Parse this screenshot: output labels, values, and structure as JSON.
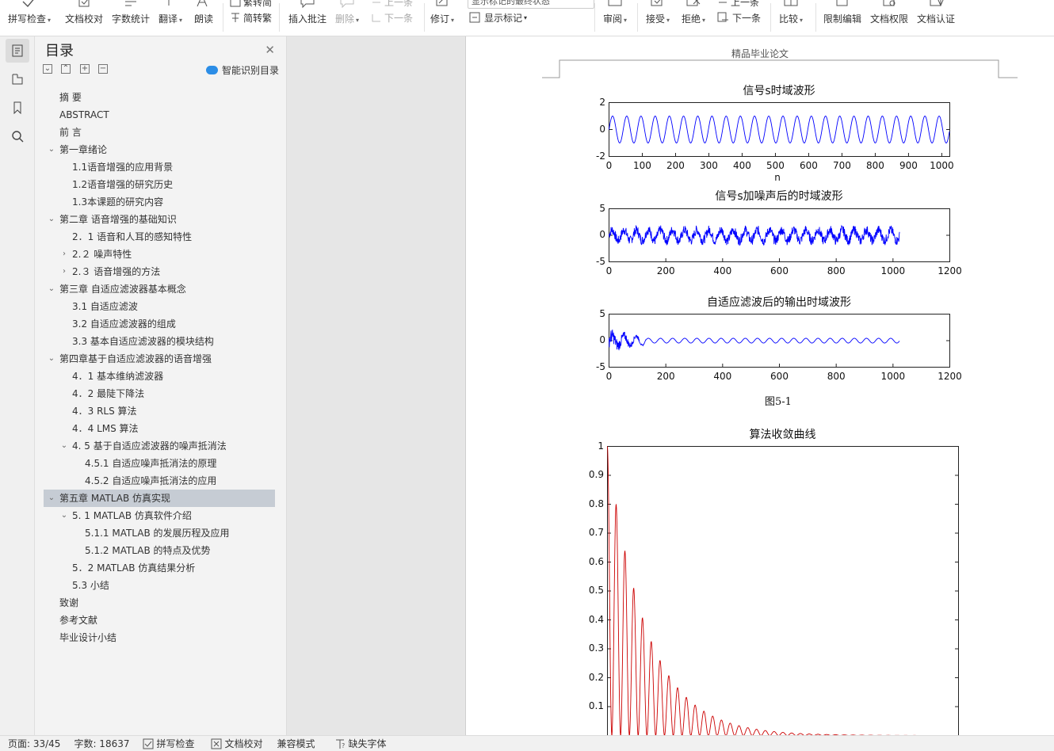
{
  "ribbon": {
    "spell_check": "拼写检查",
    "doc_proof": "文档校对",
    "word_count": "字数统计",
    "translate": "翻译",
    "read_aloud": "朗读",
    "trad_simp_top": "繁转简",
    "simp_trad": "简转繁",
    "insert_comment": "插入批注",
    "delete": "删除",
    "prev_top": "上一条",
    "next": "下一条",
    "revise": "修订",
    "show_markup_top": "显示标记的最终状态",
    "show_markup": "显示标记",
    "review": "审阅",
    "accept": "接受",
    "reject": "拒绝",
    "prev_change_top": "上一条",
    "next_change": "下一条",
    "compare": "比较",
    "restrict_edit": "限制编辑",
    "doc_permission": "文档权限",
    "doc_certify": "文档认证"
  },
  "toc": {
    "title": "目录",
    "smart": "智能识别目录",
    "items": [
      {
        "label": "摘  要",
        "level": 1,
        "arrow": ""
      },
      {
        "label": "ABSTRACT",
        "level": 1,
        "arrow": ""
      },
      {
        "label": "前  言",
        "level": 1,
        "arrow": ""
      },
      {
        "label": "第一章绪论",
        "level": 1,
        "arrow": "down"
      },
      {
        "label": "1.1语音增强的应用背景",
        "level": 2,
        "arrow": ""
      },
      {
        "label": "1.2语音增强的研究历史",
        "level": 2,
        "arrow": ""
      },
      {
        "label": "1.3本课题的研究内容",
        "level": 2,
        "arrow": ""
      },
      {
        "label": "第二章 语音增强的基础知识",
        "level": 1,
        "arrow": "down"
      },
      {
        "label": "2．1 语音和人耳的感知特性",
        "level": 2,
        "arrow": ""
      },
      {
        "label": "2.２ 噪声特性",
        "level": 2,
        "arrow": "right"
      },
      {
        "label": "2.３   语音增强的方法",
        "level": 2,
        "arrow": "right"
      },
      {
        "label": "第三章   自适应滤波器基本概念",
        "level": 1,
        "arrow": "down"
      },
      {
        "label": "3.1 自适应滤波",
        "level": 2,
        "arrow": ""
      },
      {
        "label": "3.2 自适应滤波器的组成",
        "level": 2,
        "arrow": ""
      },
      {
        "label": "3.3 基本自适应滤波器的模块结构",
        "level": 2,
        "arrow": ""
      },
      {
        "label": "第四章基于自适应滤波器的语音增强",
        "level": 1,
        "arrow": "down"
      },
      {
        "label": "4．1     基本维纳滤波器",
        "level": 2,
        "arrow": ""
      },
      {
        "label": "4．2 最陡下降法",
        "level": 2,
        "arrow": ""
      },
      {
        "label": "4．3    RLS 算法",
        "level": 2,
        "arrow": ""
      },
      {
        "label": "4．4    LMS 算法",
        "level": 2,
        "arrow": ""
      },
      {
        "label": "4. 5  基于自适应滤波器的噪声抵消法",
        "level": 2,
        "arrow": "down"
      },
      {
        "label": "4.5.1 自适应噪声抵消法的原理",
        "level": 3,
        "arrow": ""
      },
      {
        "label": "4.5.2 自适应噪声抵消法的应用",
        "level": 3,
        "arrow": ""
      },
      {
        "label": "第五章  MATLAB 仿真实现",
        "level": 1,
        "arrow": "down",
        "selected": true
      },
      {
        "label": "5. 1 MATLAB 仿真软件介绍",
        "level": 2,
        "arrow": "down"
      },
      {
        "label": "5.1.1 MATLAB 的发展历程及应用",
        "level": 3,
        "arrow": ""
      },
      {
        "label": "5.1.2    MATLAB 的特点及优势",
        "level": 3,
        "arrow": ""
      },
      {
        "label": "5．2    MATLAB 仿真结果分析",
        "level": 2,
        "arrow": ""
      },
      {
        "label": "5.3 小结",
        "level": 2,
        "arrow": ""
      },
      {
        "label": "致谢",
        "level": 1,
        "arrow": ""
      },
      {
        "label": "参考文献",
        "level": 1,
        "arrow": ""
      },
      {
        "label": "毕业设计小结",
        "level": 1,
        "arrow": ""
      }
    ]
  },
  "document": {
    "header": "精品毕业论文",
    "figure_caption": "图5-1"
  },
  "chart_data": [
    {
      "type": "line",
      "title": "信号s时域波形",
      "xlabel": "n",
      "ylabel": "",
      "xlim": [
        0,
        1024
      ],
      "ylim": [
        -2,
        2
      ],
      "xticks": [
        0,
        100,
        200,
        300,
        400,
        500,
        600,
        700,
        800,
        900,
        1000
      ],
      "yticks": [
        2,
        0,
        -2
      ],
      "series": [
        {
          "color": "#0000ff",
          "cycles": 24,
          "amplitude": 1.0,
          "n": 1024
        }
      ]
    },
    {
      "type": "line",
      "title": "信号s加噪声后的时域波形",
      "xlabel": "",
      "ylabel": "",
      "xlim": [
        0,
        1200
      ],
      "ylim": [
        -5,
        5
      ],
      "xticks": [
        0,
        200,
        400,
        600,
        800,
        1000,
        1200
      ],
      "yticks": [
        5,
        0,
        -5
      ],
      "series": [
        {
          "color": "#0000ff",
          "cycles": 24,
          "amplitude": 1.0,
          "noise_amplitude": 0.9,
          "n": 1024
        }
      ]
    },
    {
      "type": "line",
      "title": "自适应滤波后的输出时域波形",
      "xlabel": "",
      "ylabel": "",
      "xlim": [
        0,
        1200
      ],
      "ylim": [
        -5,
        5
      ],
      "xticks": [
        0,
        200,
        400,
        600,
        800,
        1000,
        1200
      ],
      "yticks": [
        5,
        0,
        -5
      ],
      "series": [
        {
          "color": "#0000ff",
          "cycles": 24,
          "amplitude": 0.45,
          "transient_until": 130,
          "n": 1024
        }
      ]
    },
    {
      "type": "line",
      "title": "算法收敛曲线",
      "xlabel": "",
      "ylabel": "",
      "ylim": [
        0,
        1
      ],
      "yticks": [
        1,
        0.9,
        0.8,
        0.7,
        0.6,
        0.5,
        0.4,
        0.3,
        0.2,
        0.1
      ],
      "series": [
        {
          "color": "#cc0000",
          "peak": 1.0,
          "decay": "oscillating, decays toward 0"
        }
      ]
    }
  ],
  "status": {
    "page": "页面: 33/45",
    "words": "字数: 18637",
    "spell_check": "拼写检查",
    "doc_proof": "文档校对",
    "compat": "兼容模式",
    "missing_font": "缺失字体"
  }
}
